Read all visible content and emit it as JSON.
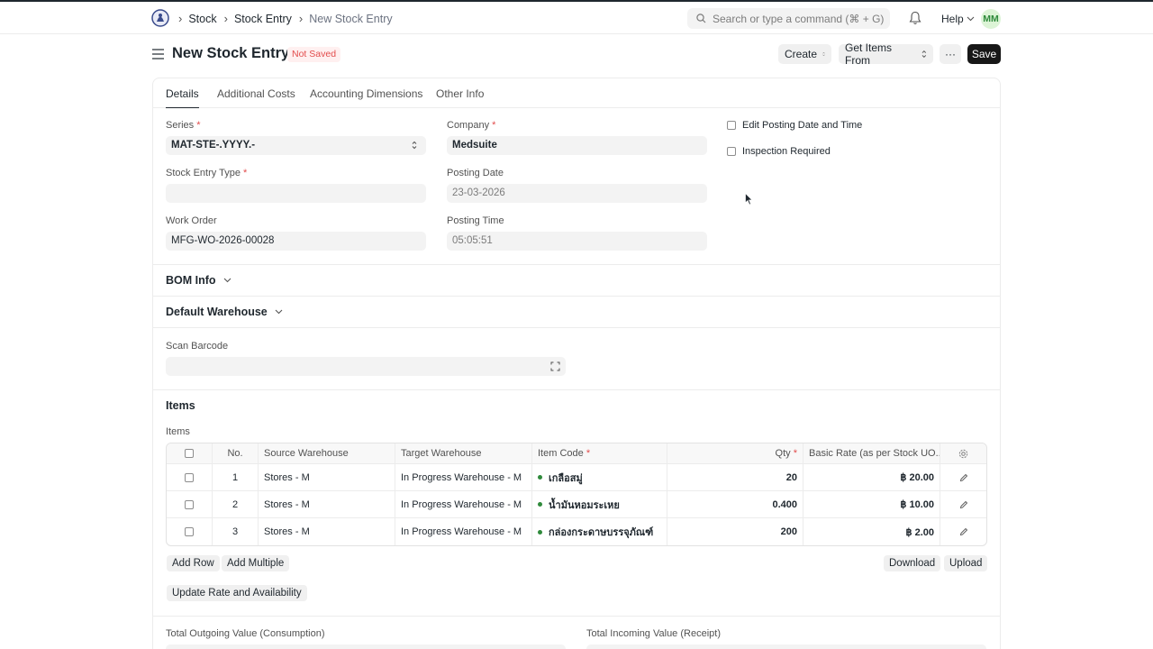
{
  "breadcrumbs": [
    "Stock",
    "Stock Entry",
    "New Stock Entry"
  ],
  "search": {
    "placeholder": "Search or type a command (⌘ + G)"
  },
  "navbar": {
    "help_label": "Help",
    "avatar_initials": "MM"
  },
  "page": {
    "title": "New Stock Entry",
    "status_badge": "Not Saved",
    "actions": {
      "create": "Create",
      "get_items_from": "Get Items From",
      "more": "···",
      "save": "Save"
    }
  },
  "tabs": [
    "Details",
    "Additional Costs",
    "Accounting Dimensions",
    "Other Info"
  ],
  "form": {
    "series": {
      "label": "Series",
      "value": "MAT-STE-.YYYY.-"
    },
    "company": {
      "label": "Company",
      "value": "Medsuite"
    },
    "stock_entry_type": {
      "label": "Stock Entry Type",
      "value": ""
    },
    "posting_date": {
      "label": "Posting Date",
      "value": "23-03-2026"
    },
    "work_order": {
      "label": "Work Order",
      "value": "MFG-WO-2026-00028"
    },
    "posting_time": {
      "label": "Posting Time",
      "value": "05:05:51"
    },
    "edit_posting": "Edit Posting Date and Time",
    "inspection_required": "Inspection Required"
  },
  "sections": {
    "bom_info": "BOM Info",
    "default_warehouse": "Default Warehouse",
    "scan_barcode_label": "Scan Barcode",
    "items_heading": "Items",
    "items_label": "Items"
  },
  "items_table": {
    "headers": [
      "No.",
      "Source Warehouse",
      "Target Warehouse",
      "Item Code",
      "Qty",
      "Basic Rate (as per Stock UO..."
    ],
    "rows": [
      {
        "no": "1",
        "source": "Stores - M",
        "target": "In Progress Warehouse - M",
        "item": "เกลือสมู่",
        "qty": "20",
        "rate": "฿ 20.00"
      },
      {
        "no": "2",
        "source": "Stores - M",
        "target": "In Progress Warehouse - M",
        "item": "น้ำมันหอมระเหย",
        "qty": "0.400",
        "rate": "฿ 10.00"
      },
      {
        "no": "3",
        "source": "Stores - M",
        "target": "In Progress Warehouse - M",
        "item": "กล่องกระดาษบรรจุภัณฑ์",
        "qty": "200",
        "rate": "฿ 2.00"
      }
    ],
    "buttons": {
      "add_row": "Add Row",
      "add_multiple": "Add Multiple",
      "download": "Download",
      "upload": "Upload",
      "update_rate": "Update Rate and Availability"
    }
  },
  "totals": {
    "outgoing_label": "Total Outgoing Value (Consumption)",
    "incoming_label": "Total Incoming Value (Receipt)"
  },
  "colors": {
    "save_bg": "#171717",
    "badge_text": "#e24c4c",
    "badge_bg": "#fff0f0",
    "avatar_bg": "#dcf4d6",
    "avatar_text": "#2f8a3b",
    "required": "#e24c4c",
    "item_dot": "#2f8a3b"
  }
}
